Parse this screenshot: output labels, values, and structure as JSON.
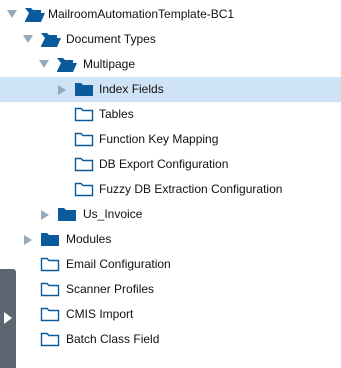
{
  "colors": {
    "folder": "#0a5a9c",
    "toggle": "#95a9bc",
    "selected_row": "#cfe3f6",
    "side_tab": "#5c6670"
  },
  "tree": {
    "root": {
      "label": "MailroomAutomationTemplate-BC1",
      "icon": "folder-open-icon",
      "state": "expanded"
    },
    "document_types": {
      "label": "Document Types",
      "icon": "folder-open-icon",
      "state": "expanded"
    },
    "multipage": {
      "label": "Multipage",
      "icon": "folder-open-icon",
      "state": "expanded"
    },
    "index_fields": {
      "label": "Index Fields",
      "icon": "folder-closed-filled-icon",
      "state": "collapsed",
      "selected": true
    },
    "tables": {
      "label": "Tables",
      "icon": "folder-outline-icon"
    },
    "function_key_mapping": {
      "label": "Function Key Mapping",
      "icon": "folder-outline-icon"
    },
    "db_export_configuration": {
      "label": "DB Export Configuration",
      "icon": "folder-outline-icon"
    },
    "fuzzy_db_extraction_configuration": {
      "label": "Fuzzy DB Extraction Configuration",
      "icon": "folder-outline-icon"
    },
    "us_invoice": {
      "label": "Us_Invoice",
      "icon": "folder-closed-filled-icon",
      "state": "collapsed"
    },
    "modules": {
      "label": "Modules",
      "icon": "folder-closed-filled-icon",
      "state": "collapsed"
    },
    "email_configuration": {
      "label": "Email Configuration",
      "icon": "folder-outline-icon"
    },
    "scanner_profiles": {
      "label": "Scanner Profiles",
      "icon": "folder-outline-icon"
    },
    "cmis_import": {
      "label": "CMIS Import",
      "icon": "folder-outline-icon"
    },
    "batch_class_field": {
      "label": "Batch Class Field",
      "icon": "folder-outline-icon"
    }
  },
  "side_panel_toggle": {
    "icon": "chevron-right-icon"
  }
}
